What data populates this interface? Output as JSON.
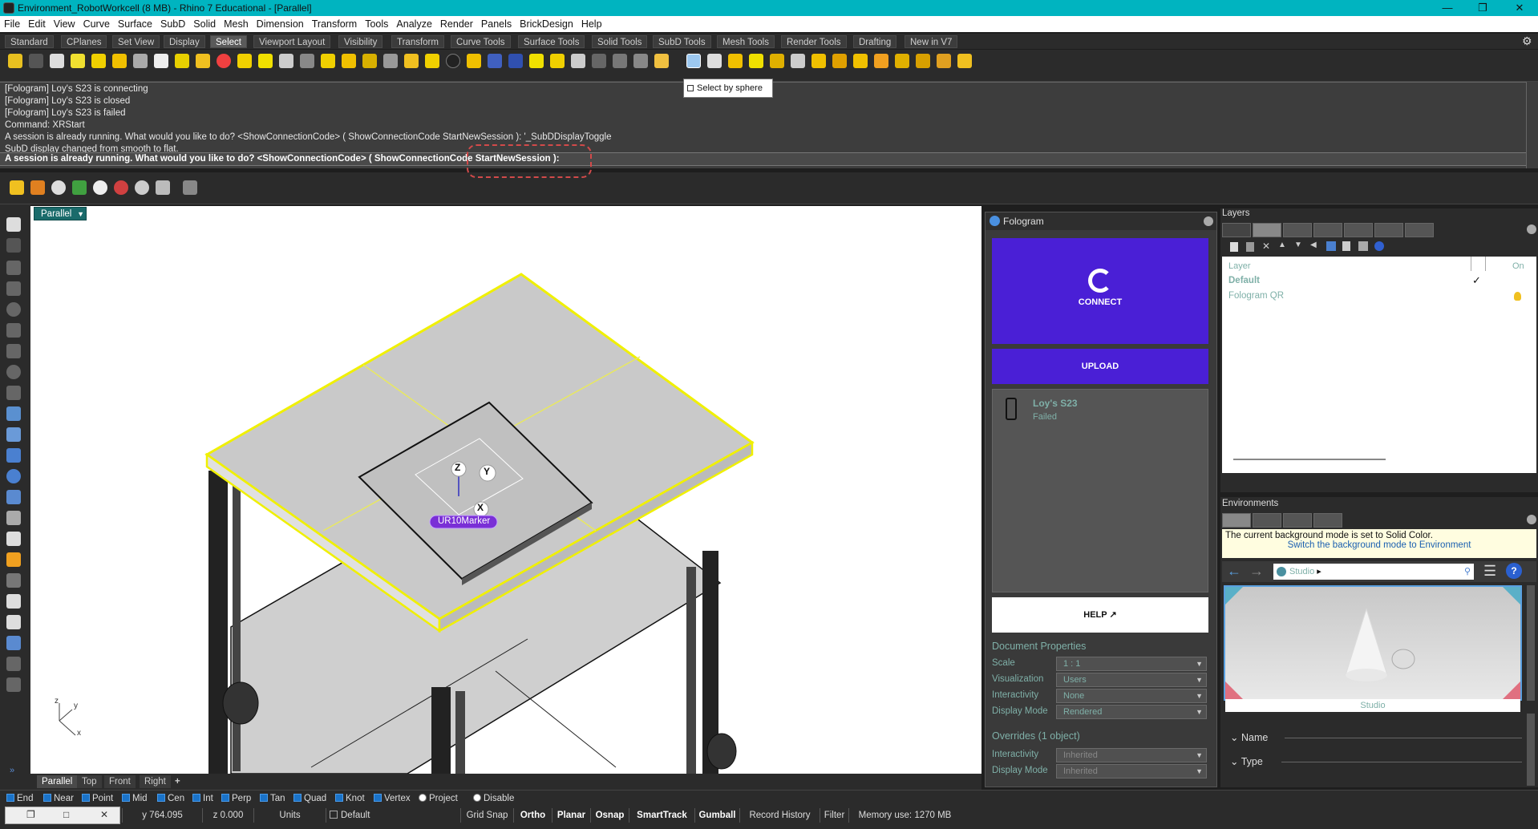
{
  "window": {
    "title": "Environment_RobotWorkcell (8 MB) - Rhino 7 Educational - [Parallel]"
  },
  "menu": [
    "File",
    "Edit",
    "View",
    "Curve",
    "Surface",
    "SubD",
    "Solid",
    "Mesh",
    "Dimension",
    "Transform",
    "Tools",
    "Analyze",
    "Render",
    "Panels",
    "BrickDesign",
    "Help"
  ],
  "tabs": [
    "Standard",
    "CPlanes",
    "Set View",
    "Display",
    "Select",
    "Viewport Layout",
    "Visibility",
    "Transform",
    "Curve Tools",
    "Surface Tools",
    "Solid Tools",
    "SubD Tools",
    "Mesh Tools",
    "Render Tools",
    "Drafting",
    "New in V7"
  ],
  "active_tab": "Select",
  "tooltip": "Select by sphere",
  "command_history": [
    "[Fologram] Loy's S23 is connecting",
    "[Fologram] Loy's S23 is closed",
    "[Fologram] Loy's S23 is failed",
    "Command: XRStart",
    "A session is already running. What would you like to do? <ShowConnectionCode> ( ShowConnectionCode  StartNewSession ): '_SubDDisplayToggle",
    "SubD display changed from smooth to flat."
  ],
  "command_prompt": "A session is already running. What would you like to do? <ShowConnectionCode> ( ShowConnectionCode  StartNewSession ):",
  "viewport": {
    "name": "Parallel",
    "marker_label": "UR10Marker",
    "axis_z": "Z",
    "axis_y": "Y",
    "axis_x": "X",
    "mini_z": "z",
    "mini_y": "y",
    "mini_x": "x",
    "tabs": [
      "Parallel",
      "Top",
      "Front",
      "Right"
    ],
    "add_tab": "+"
  },
  "fologram": {
    "title": "Fologram",
    "connect": "CONNECT",
    "upload": "UPLOAD",
    "device_name": "Loy's S23",
    "device_status": "Failed",
    "help": "HELP",
    "doc_props_title": "Document Properties",
    "props": [
      {
        "label": "Scale",
        "value": "1 : 1"
      },
      {
        "label": "Visualization",
        "value": "Users"
      },
      {
        "label": "Interactivity",
        "value": "None"
      },
      {
        "label": "Display Mode",
        "value": "Rendered"
      }
    ],
    "overrides_title": "Overrides (1 object)",
    "overrides": [
      {
        "label": "Interactivity",
        "value": "Inherited"
      },
      {
        "label": "Display Mode",
        "value": "Inherited"
      }
    ]
  },
  "layers": {
    "title": "Layers",
    "col_layer": "Layer",
    "col_on": "On",
    "rows": [
      {
        "name": "Default",
        "current": "✓"
      },
      {
        "name": "Fologram QR",
        "current": ""
      }
    ]
  },
  "environments": {
    "title": "Environments",
    "message": "The current background mode is set to Solid Color.",
    "link": "Switch the background mode to Environment",
    "breadcrumb": "Studio",
    "thumb_label": "Studio",
    "name_label": "Name",
    "type_label": "Type"
  },
  "osnaps": [
    {
      "label": "End",
      "on": true
    },
    {
      "label": "Near",
      "on": true
    },
    {
      "label": "Point",
      "on": true
    },
    {
      "label": "Mid",
      "on": true
    },
    {
      "label": "Cen",
      "on": true
    },
    {
      "label": "Int",
      "on": true
    },
    {
      "label": "Perp",
      "on": true
    },
    {
      "label": "Tan",
      "on": true
    },
    {
      "label": "Quad",
      "on": true
    },
    {
      "label": "Knot",
      "on": true
    },
    {
      "label": "Vertex",
      "on": true
    },
    {
      "label": "Project",
      "on": false
    },
    {
      "label": "Disable",
      "on": false
    }
  ],
  "status": {
    "y": "y 764.095",
    "z": "z 0.000",
    "units": "Units",
    "layer": "Default",
    "grid_snap": "Grid Snap",
    "ortho": "Ortho",
    "planar": "Planar",
    "osnap": "Osnap",
    "smarttrack": "SmartTrack",
    "gumball": "Gumball",
    "record_history": "Record History",
    "filter": "Filter",
    "memory": "Memory use: 1270 MB"
  },
  "colors": {
    "titlebar": "#00b4c0",
    "fologram_purple": "#4a1fd6",
    "selection_yellow": "#f0f000",
    "marker_purple": "#7a2fd6"
  }
}
